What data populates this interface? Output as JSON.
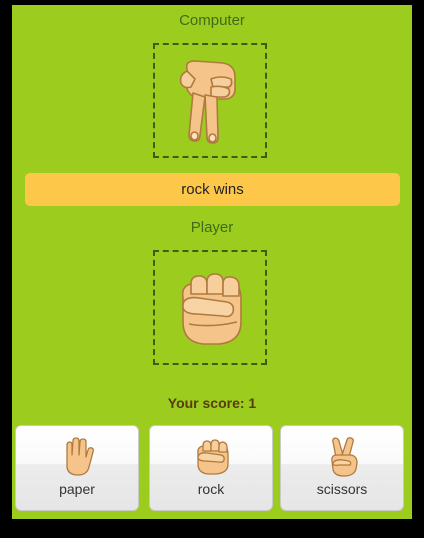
{
  "computer": {
    "label": "Computer",
    "hand": "scissors"
  },
  "result": {
    "text": "rock wins"
  },
  "player": {
    "label": "Player",
    "hand": "rock"
  },
  "score": {
    "text": "Your score: 1"
  },
  "choices": [
    {
      "label": "paper",
      "icon": "paper-hand-icon"
    },
    {
      "label": "rock",
      "icon": "rock-fist-icon"
    },
    {
      "label": "scissors",
      "icon": "scissors-hand-icon"
    }
  ],
  "colors": {
    "background": "#9ccd1e",
    "result_bar": "#fdc74a",
    "skin": "#f5c48a"
  }
}
